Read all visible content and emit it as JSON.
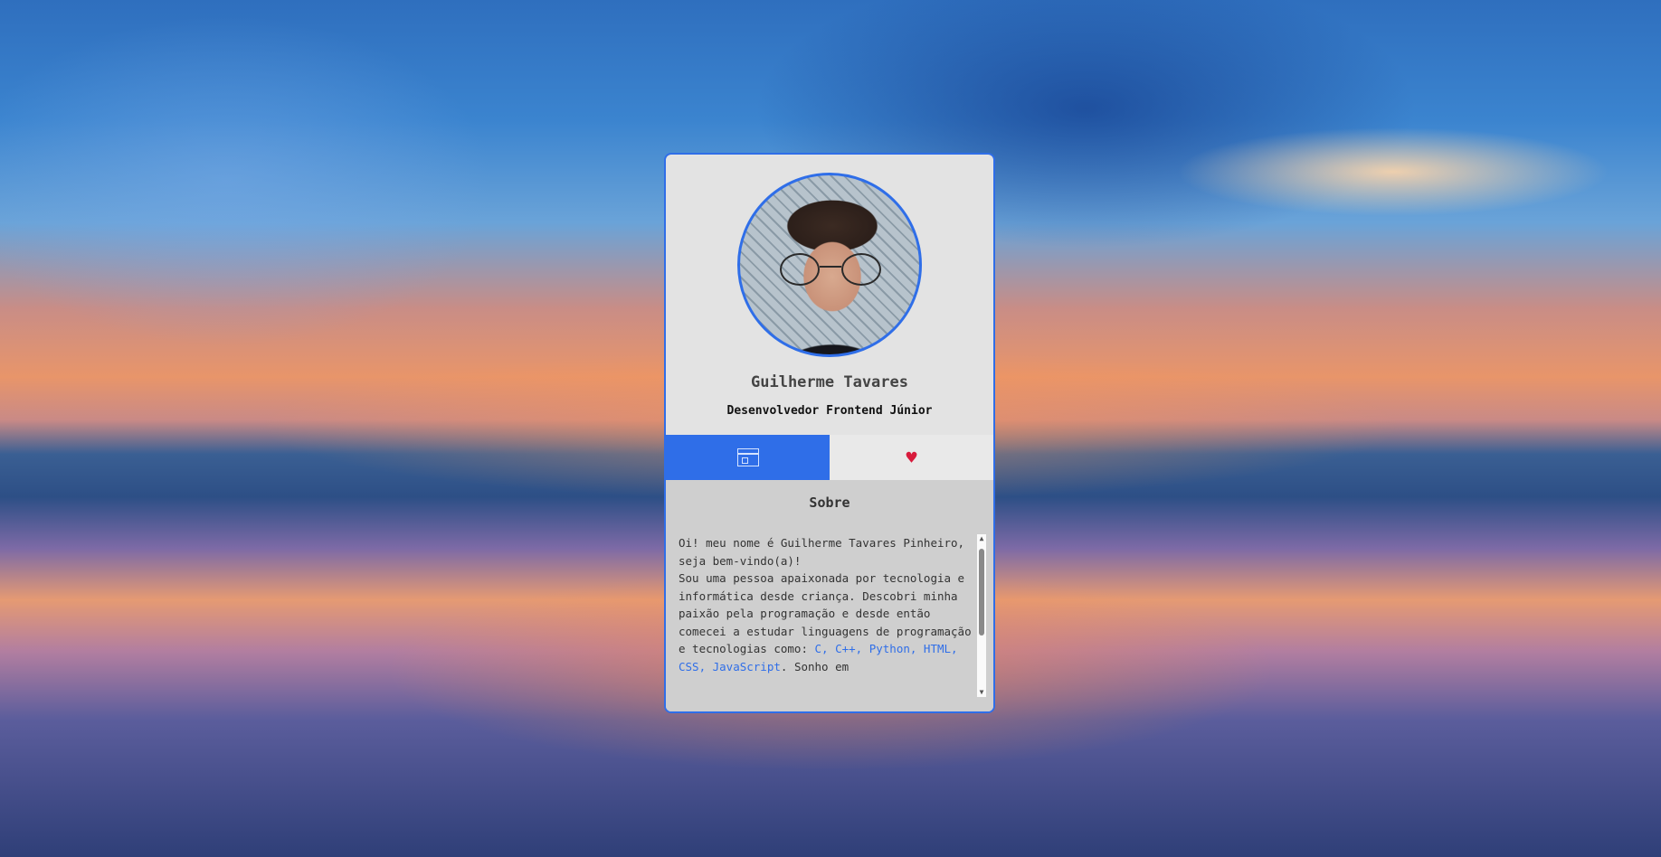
{
  "profile": {
    "name": "Guilherme Tavares",
    "role": "Desenvolvedor Frontend Júnior"
  },
  "tabs": [
    {
      "icon": "window-icon",
      "active": true
    },
    {
      "icon": "heart-icon",
      "active": false
    }
  ],
  "about": {
    "title": "Sobre",
    "line1": "Oi! meu nome é Guilherme Tavares Pinheiro, seja bem-vindo(a)!",
    "line2": "Sou uma pessoa apaixonada por tecnologia e informática desde criança. Descobri minha paixão pela programação e desde então comecei a estudar linguagens de programação e tecnologias como: ",
    "technologies": "C, C++, Python, HTML, CSS, JavaScript",
    "line3": ". Sonho em"
  },
  "colors": {
    "accent": "#2f6ee8",
    "card_bg": "#e3e3e3",
    "panel_bg": "#cfcfcf",
    "heart": "#d81b3c"
  }
}
